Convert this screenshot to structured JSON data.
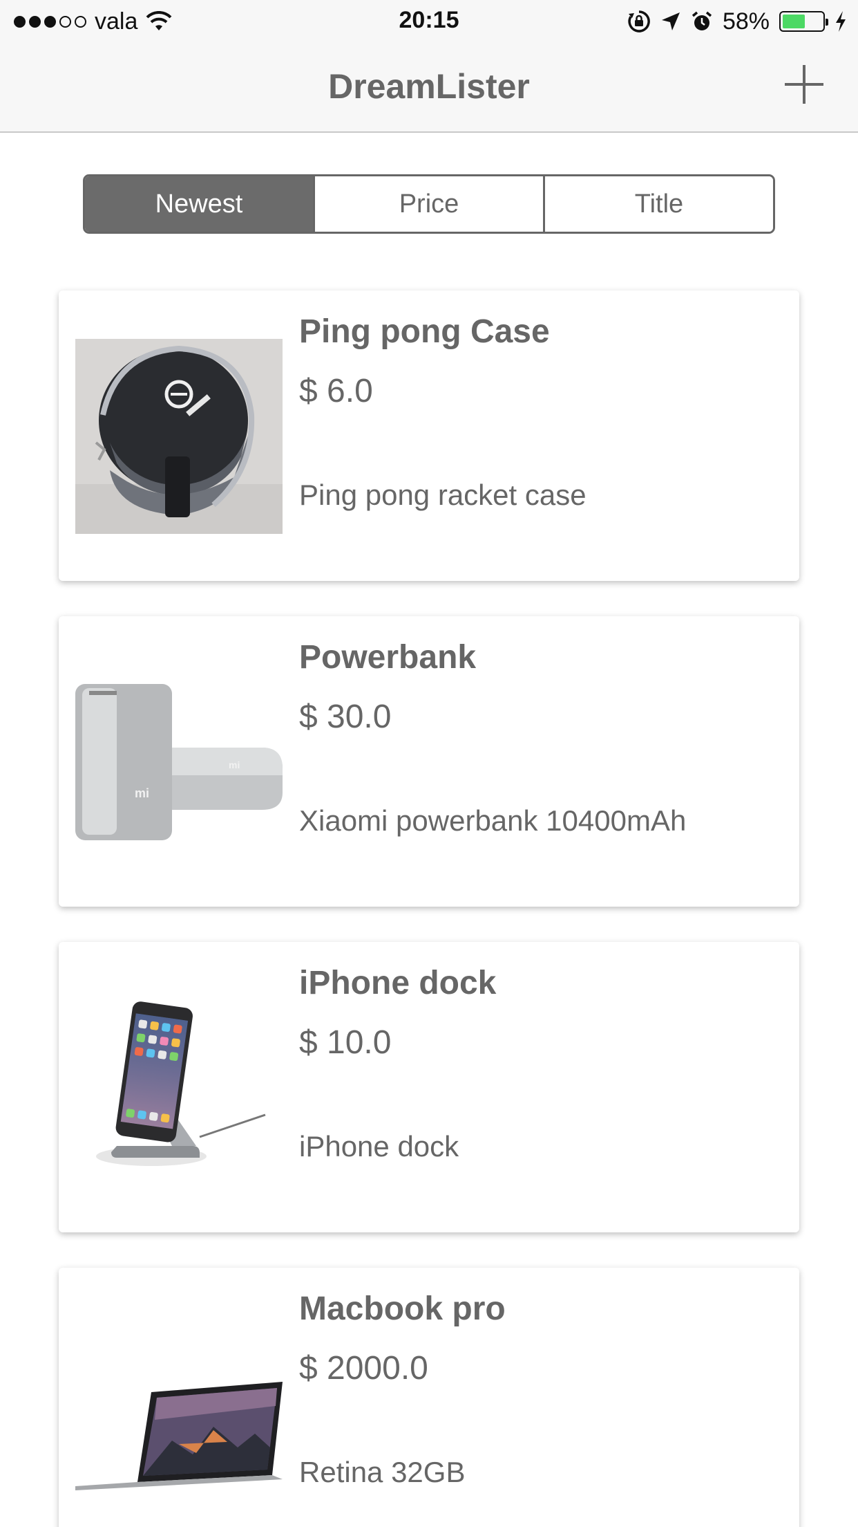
{
  "status_bar": {
    "carrier": "vala",
    "time": "20:15",
    "battery_percent": "58%",
    "battery_level": 0.58,
    "icons": [
      "signal-dots-icon",
      "wifi-icon",
      "rotation-lock-icon",
      "location-arrow-icon",
      "alarm-icon",
      "battery-icon",
      "charging-bolt-icon"
    ]
  },
  "nav": {
    "title": "DreamLister",
    "add_icon": "plus-icon"
  },
  "sort": {
    "options": [
      "Newest",
      "Price",
      "Title"
    ],
    "selected": "Newest"
  },
  "items": [
    {
      "title": "Ping pong Case",
      "price": "$ 6.0",
      "details": "Ping pong racket case",
      "thumbnail": "ping-pong-case-image"
    },
    {
      "title": "Powerbank",
      "price": "$ 30.0",
      "details": "Xiaomi powerbank 10400mAh",
      "thumbnail": "powerbank-image"
    },
    {
      "title": "iPhone dock",
      "price": "$ 10.0",
      "details": "iPhone dock",
      "thumbnail": "iphone-dock-image"
    },
    {
      "title": "Macbook pro",
      "price": "$ 2000.0",
      "details": "Retina 32GB",
      "thumbnail": "macbook-image"
    }
  ],
  "colors": {
    "text": "#666666",
    "bar_background": "#f7f7f7",
    "segment_active": "#6b6b6b",
    "battery": "#4cd964"
  }
}
